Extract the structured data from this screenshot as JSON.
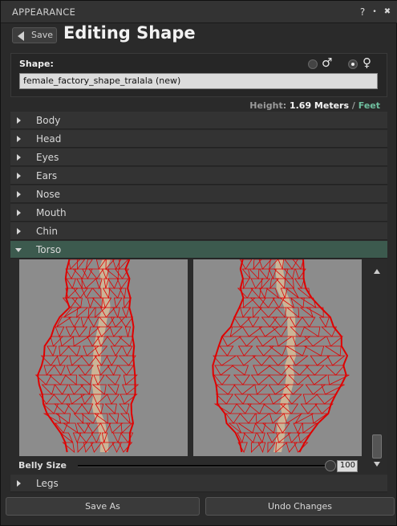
{
  "window": {
    "title": "APPEARANCE",
    "help": "?",
    "minimize": "•",
    "close": "✖"
  },
  "header": {
    "back_label": "Save",
    "title": "Editing Shape"
  },
  "shape": {
    "label": "Shape:",
    "male_symbol": "♂",
    "female_symbol": "♀",
    "selected_sex": "female",
    "name_value": "female_factory_shape_tralala (new)"
  },
  "height": {
    "label": "Height:",
    "value": "1.69 Meters",
    "separator": "/",
    "alt_unit": "Feet"
  },
  "sections": [
    {
      "label": "Body",
      "expanded": false
    },
    {
      "label": "Head",
      "expanded": false
    },
    {
      "label": "Eyes",
      "expanded": false
    },
    {
      "label": "Ears",
      "expanded": false
    },
    {
      "label": "Nose",
      "expanded": false
    },
    {
      "label": "Mouth",
      "expanded": false
    },
    {
      "label": "Chin",
      "expanded": false
    },
    {
      "label": "Torso",
      "expanded": true
    }
  ],
  "torso": {
    "slider_label": "Belly Size",
    "slider_value": "100",
    "slider_fraction": 1.0
  },
  "after_sections": [
    {
      "label": "Legs",
      "expanded": false
    }
  ],
  "buttons": {
    "save_as": "Save As",
    "undo": "Undo Changes"
  },
  "colors": {
    "accent_row": "#3c5a4e",
    "link": "#6fbf9f",
    "wire": "#e00000",
    "wire_light": "#ffd7a0"
  }
}
